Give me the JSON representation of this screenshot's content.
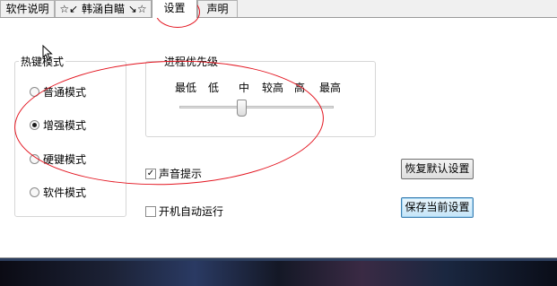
{
  "tabs": [
    {
      "label": "软件说明"
    },
    {
      "label": "☆↙ 韩涵自瞄 ↘☆"
    },
    {
      "label": "设置",
      "active": true
    },
    {
      "label": "声明"
    }
  ],
  "hotkey_group": {
    "title": "热键模式",
    "options": [
      {
        "label": "普通模式",
        "checked": false
      },
      {
        "label": "增强模式",
        "checked": true
      },
      {
        "label": "硬键模式",
        "checked": false
      },
      {
        "label": "软件模式",
        "checked": false
      }
    ]
  },
  "priority_group": {
    "title": "进程优先级",
    "ticks": [
      "最低",
      "低",
      "中",
      "较高",
      "高",
      "最高"
    ],
    "selected_level": "中"
  },
  "checkboxes": {
    "sound": {
      "label": "声音提示",
      "checked": true
    },
    "autostart": {
      "label": "开机自动运行",
      "checked": false
    }
  },
  "buttons": {
    "restore_default": "恢复默认设置",
    "save_current": "保存当前设置"
  },
  "colors": {
    "annotation": "#e3141f",
    "panel": "#ffffff",
    "chrome": "#f0f0f0"
  },
  "icons": {
    "cursor": "mouse-pointer-icon",
    "check": "checkmark-icon"
  }
}
